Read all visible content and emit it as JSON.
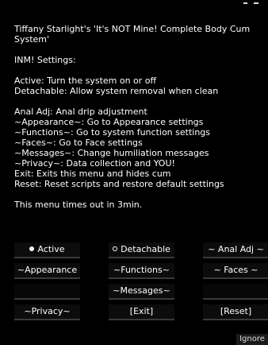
{
  "dialog": {
    "lines": [
      "Tiffany Starlight's 'It's NOT Mine! Complete Body Cum System'",
      "",
      "INM! Settings:",
      "",
      "Active: Turn the system on or off",
      "Detachable: Allow system removal when clean",
      "",
      "Anal Adj: Anal drip adjustment",
      "~Appearance~: Go to Appearance settings",
      "~Functions~: Go to system function settings",
      "~Faces~: Go to Face settings",
      "~Messages~: Change humiliation messages",
      "~Privacy~: Data collection and YOU!",
      "Exit: Exits this menu and hides cum",
      "Reset: Reset scripts and restore default settings",
      "",
      "This menu times out in 3min."
    ]
  },
  "buttons": {
    "active": "Active",
    "detachable": "Detachable",
    "anal_adj": "~ Anal Adj ~",
    "appearance": "~Appearance",
    "functions": "~Functions~",
    "faces": "~ Faces ~",
    "messages": "~Messages~",
    "privacy": "~Privacy~",
    "exit": "[Exit]",
    "reset": "[Reset]"
  },
  "ignore_label": "Ignore"
}
